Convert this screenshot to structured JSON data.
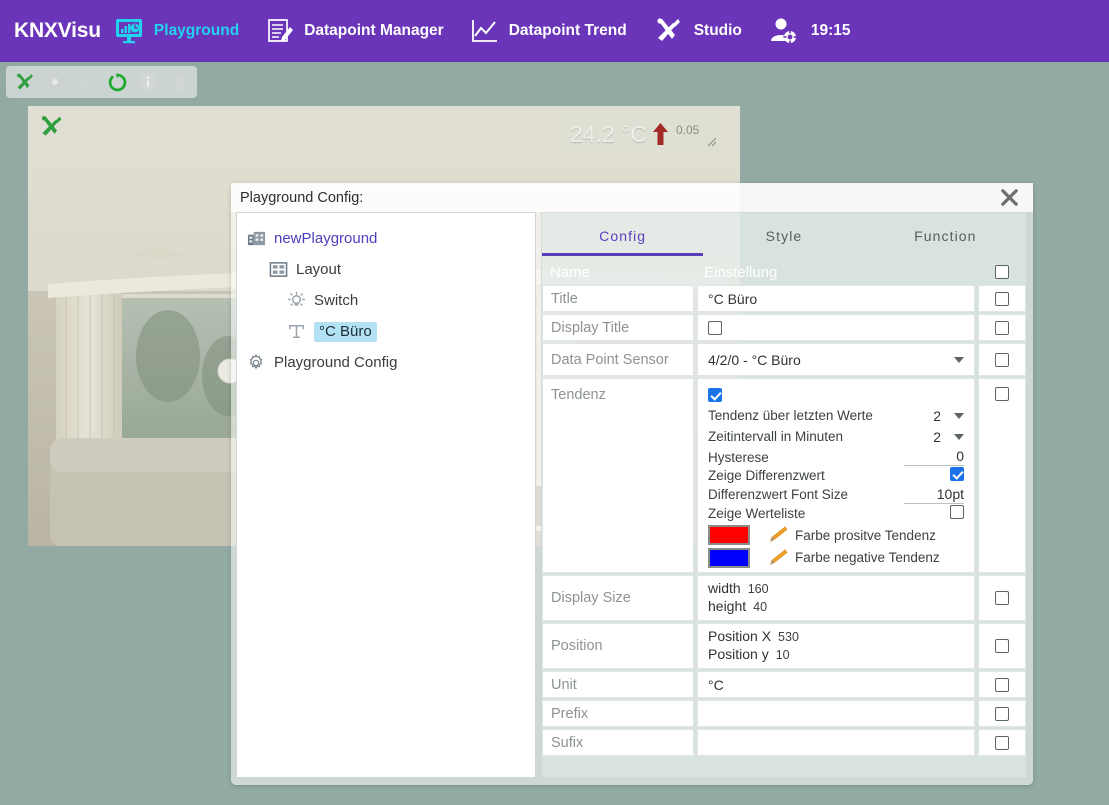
{
  "header": {
    "brand": "KNXVisu",
    "nav": [
      {
        "label": "Playground",
        "icon": "dashboard-monitor-icon",
        "accent": true
      },
      {
        "label": "Datapoint Manager",
        "icon": "document-edit-icon",
        "accent": false
      },
      {
        "label": "Datapoint Trend",
        "icon": "line-chart-icon",
        "accent": false
      },
      {
        "label": "Studio",
        "icon": "tools-hammer-wrench-icon",
        "accent": false
      }
    ],
    "user_icon": "user-settings-icon",
    "clock": "19:15",
    "brand_color": "#6a35b8",
    "accent_color": "#23d3ee"
  },
  "toolbar": {
    "buttons": [
      {
        "name": "tools-icon",
        "enabled": true
      },
      {
        "name": "gear-icon",
        "enabled": false
      },
      {
        "name": "move-arrows-icon",
        "enabled": false
      },
      {
        "name": "refresh-icon",
        "enabled": true
      },
      {
        "name": "info-icon",
        "enabled": false
      },
      {
        "name": "trash-icon",
        "enabled": false
      }
    ]
  },
  "canvas": {
    "tool_icon": "tools-icon",
    "widget": {
      "value": "24.2 °C",
      "trend_direction": "up",
      "trend_arrow_color": "#a32a24",
      "difference": "0.05"
    }
  },
  "dialog": {
    "title": "Playground Config:",
    "close_icon": "close-icon",
    "tree": [
      {
        "label": "newPlayground",
        "icon": "building-icon",
        "depth": 0,
        "selected": false,
        "root": true
      },
      {
        "label": "Layout",
        "icon": "layout-grid-icon",
        "depth": 1,
        "selected": false,
        "root": false
      },
      {
        "label": "Switch",
        "icon": "lamp-icon",
        "depth": 2,
        "selected": false,
        "root": false
      },
      {
        "label": "°C Büro",
        "icon": "text-widget-icon",
        "depth": 2,
        "selected": true,
        "root": false
      },
      {
        "label": "Playground Config",
        "icon": "gear-icon",
        "depth": 0,
        "selected": false,
        "root": false
      }
    ],
    "tabs": [
      {
        "label": "Config",
        "active": true
      },
      {
        "label": "Style",
        "active": false
      },
      {
        "label": "Function",
        "active": false
      }
    ],
    "columns": {
      "name": "Name",
      "setting": "Einstellung",
      "header_checked": false
    },
    "rows": [
      {
        "name": "Title",
        "type": "text",
        "value": "°C Büro",
        "checked": false
      },
      {
        "name": "Display Title",
        "type": "checkbox",
        "value_checked": false,
        "checked": false
      },
      {
        "name": "Data Point Sensor",
        "type": "select",
        "value": "4/2/0 - °C Büro",
        "checked": false
      },
      {
        "name": "Tendenz",
        "type": "tendenz",
        "enabled": true,
        "checked": false,
        "sub": [
          {
            "label": "Tendenz über letzten Werte",
            "control": "select",
            "value": "2"
          },
          {
            "label": "Zeitintervall in Minuten",
            "control": "select",
            "value": "2"
          },
          {
            "label": "Hysterese",
            "control": "input",
            "value": "0"
          },
          {
            "label": "Zeige Differenzwert",
            "control": "checkbox",
            "checked": true
          },
          {
            "label": "Differenzwert Font Size",
            "control": "input",
            "value": "10pt"
          },
          {
            "label": "Zeige Werteliste",
            "control": "checkbox",
            "checked": false
          }
        ],
        "colors": [
          {
            "label": "Farbe prositve Tendenz",
            "swatch": "#ff0000",
            "edit_icon": "pencil-icon"
          },
          {
            "label": "Farbe negative Tendenz",
            "swatch": "#0000ff",
            "edit_icon": "pencil-icon"
          }
        ]
      },
      {
        "name": "Display Size",
        "type": "pairs",
        "checked": false,
        "pairs": [
          {
            "key": "width",
            "value": "160"
          },
          {
            "key": "height",
            "value": "40"
          }
        ]
      },
      {
        "name": "Position",
        "type": "pairs",
        "checked": false,
        "pairs": [
          {
            "key": "Position X",
            "value": "530"
          },
          {
            "key": "Position y",
            "value": "10"
          }
        ]
      },
      {
        "name": "Unit",
        "type": "text",
        "value": "°C",
        "checked": false
      },
      {
        "name": "Prefix",
        "type": "text",
        "value": "",
        "checked": false
      },
      {
        "name": "Sufix",
        "type": "text",
        "value": "",
        "checked": false
      }
    ]
  }
}
